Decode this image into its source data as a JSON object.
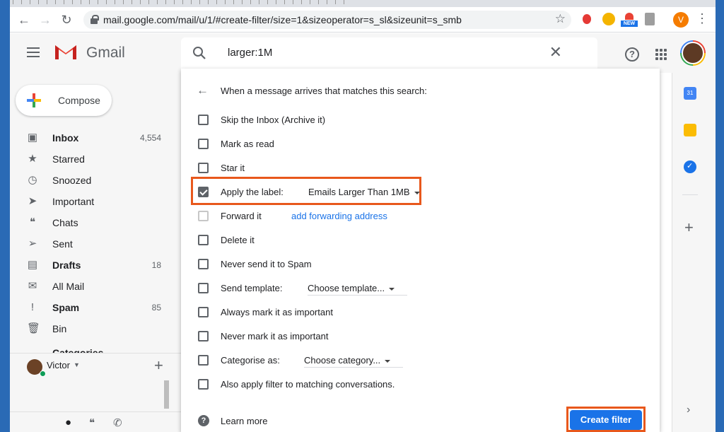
{
  "browser": {
    "url": "mail.google.com/mail/u/1/#create-filter/size=1&sizeoperator=s_sl&sizeunit=s_smb",
    "profile_initial": "V",
    "ext_new_label": "NEW"
  },
  "gmail": {
    "app_name": "Gmail",
    "search_query": "larger:1M"
  },
  "sidebar": {
    "compose_label": "Compose",
    "items": [
      {
        "label": "Inbox",
        "count": "4,554",
        "icon": "inbox-icon",
        "bold": true
      },
      {
        "label": "Starred",
        "count": "",
        "icon": "star-icon",
        "bold": false
      },
      {
        "label": "Snoozed",
        "count": "",
        "icon": "clock-icon",
        "bold": false
      },
      {
        "label": "Important",
        "count": "",
        "icon": "important-icon",
        "bold": false
      },
      {
        "label": "Chats",
        "count": "",
        "icon": "chat-icon",
        "bold": false
      },
      {
        "label": "Sent",
        "count": "",
        "icon": "send-icon",
        "bold": false
      },
      {
        "label": "Drafts",
        "count": "18",
        "icon": "draft-icon",
        "bold": true
      },
      {
        "label": "All Mail",
        "count": "",
        "icon": "mail-icon",
        "bold": false
      },
      {
        "label": "Spam",
        "count": "85",
        "icon": "spam-icon",
        "bold": true
      },
      {
        "label": "Bin",
        "count": "",
        "icon": "bin-icon",
        "bold": false
      }
    ],
    "partial_item": "Categories"
  },
  "hangouts": {
    "user_name": "Victor"
  },
  "filter": {
    "heading": "When a message arrives that matches this search:",
    "options": {
      "skip_inbox": "Skip the Inbox (Archive it)",
      "mark_read": "Mark as read",
      "star_it": "Star it",
      "apply_label": "Apply the label:",
      "apply_label_value": "Emails Larger Than 1MB",
      "forward_it": "Forward it",
      "forward_link": "add forwarding address",
      "delete_it": "Delete it",
      "never_spam": "Never send it to Spam",
      "send_template": "Send template:",
      "send_template_value": "Choose template...",
      "always_important": "Always mark it as important",
      "never_important": "Never mark it as important",
      "categorise": "Categorise as:",
      "categorise_value": "Choose category...",
      "also_apply": "Also apply filter to matching conversations."
    },
    "checked": {
      "apply_label": true
    },
    "learn_more": "Learn more",
    "create_button": "Create filter"
  },
  "side_panel": {
    "calendar_day": "31"
  },
  "colors": {
    "accent": "#1a73e8",
    "highlight": "#e8581c",
    "desktop": "#2a6ab5"
  }
}
